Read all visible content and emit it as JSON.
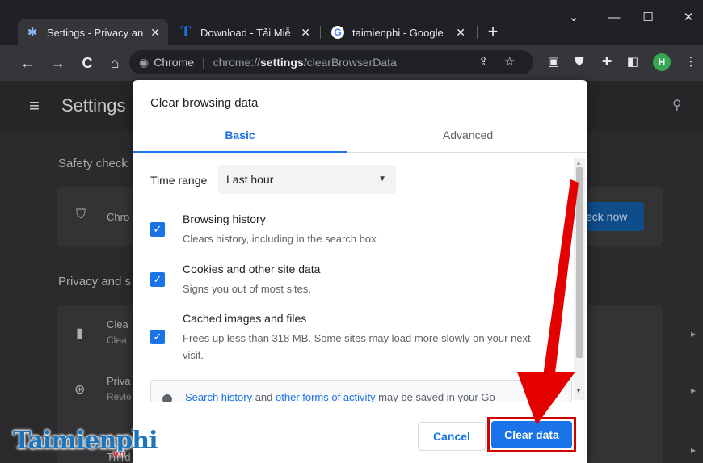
{
  "browser": {
    "tabs": [
      {
        "title": "Settings - Privacy an",
        "favicon": "settings-gear-icon",
        "active": true
      },
      {
        "title": "Download - Tải Miễ",
        "favicon": "t-favicon-icon",
        "active": false
      },
      {
        "title": "taimienphi - Google",
        "favicon": "google-icon",
        "active": false
      }
    ],
    "new_tab_symbol": "+",
    "window_controls": {
      "dropdown": "⌄",
      "minimize": "—",
      "maximize": "☐",
      "close": "✕"
    },
    "omnibox": {
      "chip": "Chrome",
      "url_scheme": "chrome://",
      "url_host": "settings",
      "url_path": "/clearBrowserData"
    },
    "profile_initial": "H"
  },
  "settings": {
    "title": "Settings",
    "safety_check_label": "Safety check",
    "safety_card_text": "Chro",
    "check_now_label": "eck now",
    "privacy_label": "Privacy and s",
    "privacy_items": [
      {
        "title": "Clea",
        "sub": "Clea"
      },
      {
        "title": "Priva",
        "sub": "Revie"
      },
      {
        "title": "Third"
      }
    ]
  },
  "dialog": {
    "title": "Clear browsing data",
    "tabs": {
      "basic": "Basic",
      "advanced": "Advanced"
    },
    "time_range_label": "Time range",
    "time_range_value": "Last hour",
    "options": [
      {
        "title": "Browsing history",
        "desc": "Clears history, including in the search box",
        "checked": true
      },
      {
        "title": "Cookies and other site data",
        "desc": "Signs you out of most sites.",
        "checked": true
      },
      {
        "title": "Cached images and files",
        "desc": "Frees up less than 318 MB. Some sites may load more slowly on your next visit.",
        "checked": true
      }
    ],
    "notice": {
      "link1": "Search history",
      "and": " and ",
      "link2": "other forms of activity",
      "rest": " may be saved in your Go"
    },
    "cancel_label": "Cancel",
    "clear_label": "Clear data"
  },
  "watermark": {
    "main": "Taimienphi",
    "sub": ".vn"
  },
  "colors": {
    "accent": "#1a73e8",
    "highlight": "#d30000",
    "browser_bg": "#202124",
    "toolbar_bg": "#35363a"
  }
}
